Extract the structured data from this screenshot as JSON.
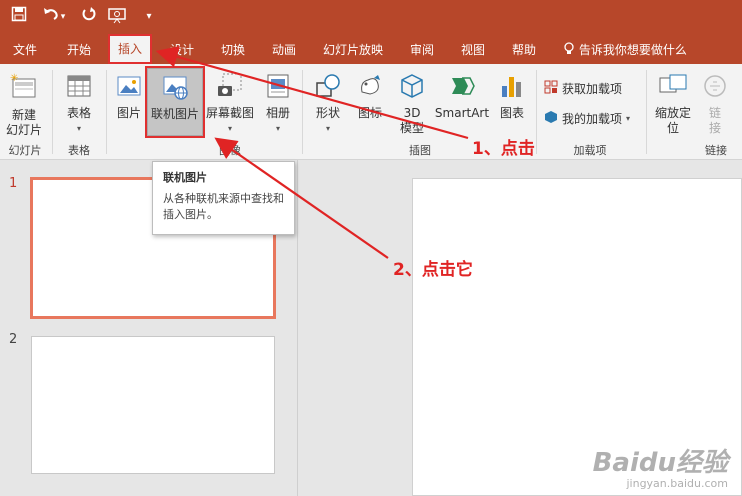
{
  "quick_access": {
    "save_icon": "save-icon",
    "undo_icon": "undo-icon",
    "redo_icon": "redo-icon",
    "present_icon": "present-icon",
    "customize_icon": "customize-icon"
  },
  "tabs": [
    {
      "label": "文件"
    },
    {
      "label": "开始"
    },
    {
      "label": "插入"
    },
    {
      "label": "设计"
    },
    {
      "label": "切换"
    },
    {
      "label": "动画"
    },
    {
      "label": "幻灯片放映"
    },
    {
      "label": "审阅"
    },
    {
      "label": "视图"
    },
    {
      "label": "帮助"
    }
  ],
  "tell_me": "告诉我你想要做什么",
  "ribbon": {
    "new_slide": "新建\n幻灯片",
    "table": "表格",
    "picture": "图片",
    "online_picture": "联机图片",
    "screenshot": "屏幕截图",
    "album": "相册",
    "shapes": "形状",
    "icons": "图标",
    "model3d": "3D\n模型",
    "smartart": "SmartArt",
    "chart": "图表",
    "get_addins": "获取加载项",
    "my_addins": "我的加载项",
    "zoom": "缩放定\n位",
    "link": "链\n接",
    "groups": {
      "slides": "幻灯片",
      "tables": "表格",
      "images": "图像",
      "illustrations": "插图",
      "addins": "加载项",
      "links": "链接"
    }
  },
  "tooltip": {
    "title": "联机图片",
    "body": "从各种联机来源中查找和插入图片。"
  },
  "slides": [
    {
      "number": "1"
    },
    {
      "number": "2"
    }
  ],
  "annotations": {
    "step1": "1、点击",
    "step2": "2、点击它"
  },
  "watermark": {
    "main": "Baidu经验",
    "sub": "jingyan.baidu.com"
  },
  "colors": {
    "accent": "#b7472a",
    "annotation": "#e02424"
  }
}
